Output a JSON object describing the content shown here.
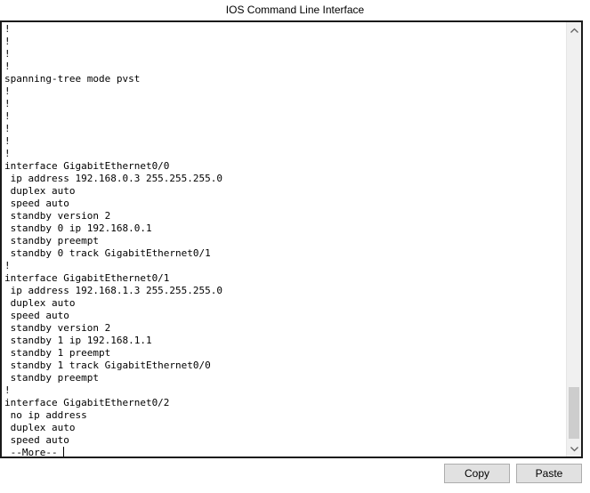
{
  "window": {
    "title": "IOS Command Line Interface"
  },
  "terminal": {
    "lines": [
      "!",
      "!",
      "!",
      "!",
      "spanning-tree mode pvst",
      "!",
      "!",
      "!",
      "!",
      "!",
      "!",
      "interface GigabitEthernet0/0",
      " ip address 192.168.0.3 255.255.255.0",
      " duplex auto",
      " speed auto",
      " standby version 2",
      " standby 0 ip 192.168.0.1",
      " standby preempt",
      " standby 0 track GigabitEthernet0/1",
      "!",
      "interface GigabitEthernet0/1",
      " ip address 192.168.1.3 255.255.255.0",
      " duplex auto",
      " speed auto",
      " standby version 2",
      " standby 1 ip 192.168.1.1",
      " standby 1 preempt",
      " standby 1 track GigabitEthernet0/0",
      " standby preempt",
      "!",
      "interface GigabitEthernet0/2",
      " no ip address",
      " duplex auto",
      " speed auto",
      " --More--"
    ],
    "scroll_position": 1.0
  },
  "buttons": {
    "copy_label": "Copy",
    "paste_label": "Paste"
  }
}
